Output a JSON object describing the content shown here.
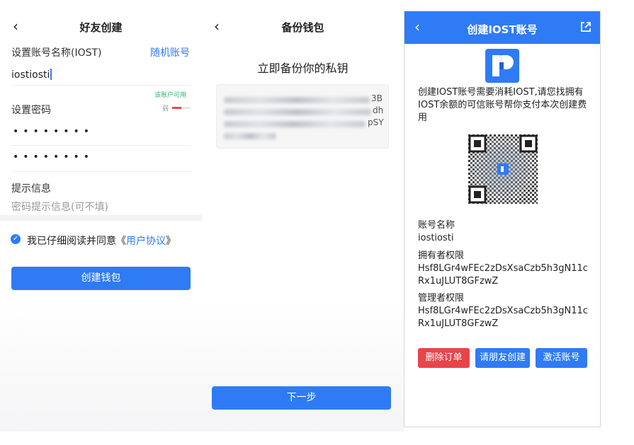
{
  "panel1": {
    "back_icon": "chevron-left-icon",
    "title": "好友创建",
    "account_label": "设置账号名称(IOST)",
    "random_account": "随机账号",
    "account_value": "iostiosti",
    "available_tip": "该账户可用",
    "password_label": "设置密码",
    "strength_text": "弱",
    "strength_color": "#e84545",
    "password_dots": "••••••••",
    "confirm_dots": "••••••••",
    "hint_label": "提示信息",
    "hint_placeholder": "密码提示信息(可不填)",
    "agree_prefix": "我已仔细阅读并同意《",
    "agree_link": "用户协议",
    "agree_suffix": "》",
    "create_button": "创建钱包"
  },
  "panel2": {
    "back_icon": "chevron-left-icon",
    "title": "备份钱包",
    "heading": "立即备份你的私钥",
    "key_visible": {
      "line1_end": "3B",
      "line2_end": "dh",
      "line3_end": "pSY"
    },
    "next_button": "下一步"
  },
  "panel3": {
    "back_icon": "chevron-left-icon",
    "title": "创建IOST账号",
    "share_icon": "external-link-icon",
    "logo_icon": "tokenpocket-logo-icon",
    "description": "创建IOST账号需要消耗IOST,请您找拥有IOST余额的可信账号帮你支付本次创建费用",
    "qr_icon": "qr-code-icon",
    "account_name_label": "账号名称",
    "account_name_value": "iostiosti",
    "owner_label": "拥有者权限",
    "owner_value": "Hsf8LGr4wFEc2zDsXsaCzb5h3gN11cRx1uJLUT8GFzwZ",
    "manager_label": "管理者权限",
    "manager_value": "Hsf8LGr4wFEc2zDsXsaCzb5h3gN11cRx1uJLUT8GFzwZ",
    "delete_button": "删除订单",
    "friend_button": "请朋友创建",
    "activate_button": "激活账号",
    "colors": {
      "primary": "#2f7bf5",
      "danger": "#e8454a"
    }
  }
}
